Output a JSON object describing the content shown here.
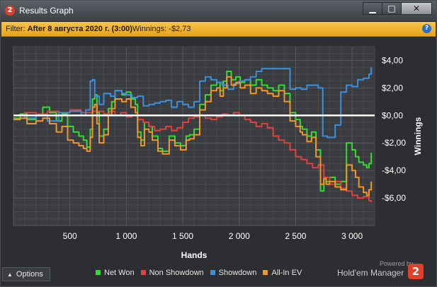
{
  "window": {
    "title": "Results Graph",
    "app_icon": "2",
    "controls": {
      "minimize": "▁",
      "maximize": "□",
      "close": "✕"
    }
  },
  "filter": {
    "label": "Filter: ",
    "value": "After 8 августа 2020 г. (3:00)",
    "winnings_label": "Winnings: ",
    "winnings_value": "-$2,73",
    "help_icon": "?"
  },
  "footer": {
    "options_label": "Options",
    "powered_by": "Powered by",
    "brand": "Hold'em Manager",
    "brand_logo": "2"
  },
  "chart_data": {
    "type": "line",
    "xlabel": "Hands",
    "ylabel": "Winnings",
    "xlim": [
      0,
      3200
    ],
    "ylim": [
      -8,
      5
    ],
    "x_ticks": [
      500,
      1000,
      1500,
      2000,
      2500,
      3000
    ],
    "x_tick_labels": [
      "500",
      "1 000",
      "1 500",
      "2 000",
      "2 500",
      "3 000"
    ],
    "y_ticks": [
      4,
      2,
      0,
      -2,
      -4,
      -6
    ],
    "y_tick_labels": [
      "$4,00",
      "$2,00",
      "$0,00",
      "-$2,00",
      "-$4,00",
      "-$6,00"
    ],
    "grid": true,
    "zero_line": true,
    "legend_position": "bottom",
    "series": [
      {
        "name": "Net Won",
        "color": "#33dd33",
        "x": [
          0,
          60,
          120,
          200,
          260,
          320,
          380,
          430,
          480,
          530,
          580,
          620,
          650,
          680,
          700,
          720,
          740,
          760,
          800,
          840,
          870,
          900,
          960,
          1000,
          1040,
          1080,
          1100,
          1130,
          1160,
          1200,
          1230,
          1280,
          1320,
          1380,
          1430,
          1480,
          1530,
          1560,
          1600,
          1650,
          1700,
          1750,
          1800,
          1830,
          1860,
          1890,
          1930,
          1970,
          2010,
          2050,
          2100,
          2150,
          2200,
          2250,
          2300,
          2350,
          2400,
          2450,
          2500,
          2540,
          2560,
          2600,
          2640,
          2680,
          2720,
          2750,
          2770,
          2800,
          2850,
          2900,
          2950,
          3000,
          3030,
          3060,
          3100,
          3130,
          3150,
          3170
        ],
        "y": [
          -0.2,
          0.1,
          -0.3,
          0.0,
          0.6,
          0.2,
          -0.4,
          0.1,
          -0.8,
          -1.2,
          -1.5,
          -1.8,
          -2.3,
          -1.0,
          1.2,
          1.5,
          0.2,
          -1.5,
          -1.0,
          0.5,
          1.0,
          1.8,
          1.5,
          1.7,
          1.2,
          0.8,
          -1.2,
          -1.8,
          -0.5,
          -0.8,
          -1.5,
          -2.4,
          -2.6,
          -1.5,
          -2.0,
          -2.2,
          -1.5,
          -1.4,
          -1.0,
          0.8,
          1.5,
          2.2,
          2.4,
          1.8,
          2.5,
          3.2,
          2.6,
          2.8,
          2.4,
          2.6,
          2.2,
          2.6,
          2.2,
          2.0,
          1.8,
          2.2,
          1.6,
          0.2,
          -0.3,
          -0.8,
          -1.0,
          -1.5,
          -1.2,
          -2.5,
          -5.5,
          -4.5,
          -4.8,
          -4.5,
          -5.0,
          -4.8,
          -2.0,
          -2.5,
          -3.0,
          -3.4,
          -3.6,
          -3.8,
          -3.5,
          -2.7
        ]
      },
      {
        "name": "Non Showdown",
        "color": "#e34040",
        "x": [
          0,
          100,
          200,
          300,
          400,
          500,
          600,
          700,
          800,
          850,
          900,
          950,
          1000,
          1050,
          1100,
          1150,
          1200,
          1250,
          1300,
          1350,
          1400,
          1450,
          1500,
          1550,
          1600,
          1650,
          1700,
          1750,
          1800,
          1850,
          1900,
          1950,
          2000,
          2050,
          2100,
          2150,
          2200,
          2250,
          2300,
          2350,
          2400,
          2450,
          2500,
          2550,
          2600,
          2650,
          2700,
          2750,
          2800,
          2850,
          2900,
          2950,
          3000,
          3050,
          3100,
          3150,
          3170
        ],
        "y": [
          0.0,
          0.2,
          0.1,
          0.3,
          0.2,
          0.4,
          0.2,
          0.3,
          0.1,
          0.3,
          0.0,
          0.2,
          -0.1,
          0.0,
          -0.3,
          -0.5,
          -0.8,
          -1.1,
          -1.0,
          -0.8,
          -1.1,
          -0.9,
          -0.5,
          -0.2,
          -0.1,
          0.0,
          -0.2,
          -0.3,
          -0.1,
          0.1,
          0.0,
          0.2,
          0.0,
          -0.3,
          -0.5,
          -0.8,
          -0.6,
          -0.9,
          -1.5,
          -1.8,
          -2.0,
          -2.5,
          -3.0,
          -3.2,
          -3.5,
          -3.8,
          -3.6,
          -4.5,
          -5.0,
          -4.8,
          -5.3,
          -5.5,
          -5.8,
          -6.0,
          -5.9,
          -6.2,
          -6.3
        ]
      },
      {
        "name": "Showdown",
        "color": "#3c8fdb",
        "x": [
          0,
          100,
          200,
          300,
          400,
          500,
          600,
          640,
          680,
          700,
          720,
          760,
          800,
          860,
          900,
          960,
          1000,
          1050,
          1100,
          1150,
          1200,
          1250,
          1300,
          1350,
          1400,
          1450,
          1500,
          1550,
          1600,
          1650,
          1700,
          1750,
          1800,
          1850,
          1900,
          1950,
          2000,
          2050,
          2100,
          2150,
          2200,
          2250,
          2300,
          2400,
          2450,
          2500,
          2550,
          2600,
          2650,
          2700,
          2740,
          2780,
          2850,
          2900,
          2950,
          3000,
          3050,
          3100,
          3150,
          3170
        ],
        "y": [
          0.0,
          -0.2,
          0.0,
          -0.4,
          0.2,
          0.3,
          0.0,
          0.4,
          2.5,
          2.6,
          1.4,
          0.8,
          1.6,
          1.4,
          1.8,
          1.6,
          1.5,
          1.3,
          1.4,
          0.7,
          0.8,
          0.9,
          1.0,
          1.1,
          0.6,
          1.0,
          0.8,
          0.6,
          1.0,
          2.5,
          2.8,
          2.6,
          2.4,
          2.2,
          1.9,
          2.3,
          2.5,
          2.6,
          2.8,
          3.2,
          3.4,
          3.4,
          3.4,
          3.4,
          1.9,
          2.0,
          1.9,
          2.2,
          2.2,
          2.0,
          -1.5,
          -1.6,
          -0.7,
          1.7,
          2.2,
          2.1,
          2.6,
          2.7,
          3.0,
          3.5
        ]
      },
      {
        "name": "All-In EV",
        "color": "#f0962b",
        "x": [
          0,
          60,
          120,
          200,
          260,
          320,
          380,
          430,
          480,
          530,
          580,
          620,
          650,
          680,
          700,
          720,
          740,
          760,
          800,
          840,
          870,
          900,
          960,
          1000,
          1040,
          1080,
          1100,
          1130,
          1160,
          1200,
          1230,
          1280,
          1320,
          1380,
          1430,
          1480,
          1530,
          1560,
          1600,
          1650,
          1700,
          1750,
          1800,
          1830,
          1860,
          1890,
          1930,
          1970,
          2010,
          2050,
          2100,
          2150,
          2200,
          2250,
          2300,
          2350,
          2400,
          2450,
          2500,
          2540,
          2560,
          2600,
          2640,
          2680,
          2720,
          2750,
          2770,
          2800,
          2850,
          2900,
          2950,
          3000,
          3030,
          3060,
          3100,
          3130,
          3150,
          3170
        ],
        "y": [
          -0.3,
          -0.2,
          -0.6,
          -0.4,
          -0.2,
          -0.6,
          -1.2,
          -0.8,
          -1.8,
          -2.0,
          -2.2,
          -2.4,
          -2.6,
          -1.6,
          0.6,
          0.8,
          -0.6,
          -2.0,
          -1.4,
          0.0,
          0.5,
          1.2,
          1.0,
          1.2,
          0.6,
          0.2,
          -1.6,
          -2.2,
          -1.0,
          -1.2,
          -1.8,
          -2.6,
          -2.8,
          -1.8,
          -2.2,
          -2.5,
          -1.8,
          -1.7,
          -1.4,
          0.4,
          1.0,
          1.8,
          2.0,
          1.4,
          2.0,
          2.8,
          2.2,
          2.4,
          2.0,
          2.2,
          1.6,
          2.0,
          1.8,
          1.6,
          1.4,
          1.8,
          1.0,
          -0.4,
          -0.8,
          -1.2,
          -1.4,
          -1.9,
          -1.6,
          -3.0,
          -5.0,
          -4.6,
          -5.0,
          -4.8,
          -5.2,
          -5.4,
          -3.6,
          -4.0,
          -4.5,
          -5.2,
          -5.6,
          -5.8,
          -5.4,
          -4.8
        ]
      }
    ]
  }
}
